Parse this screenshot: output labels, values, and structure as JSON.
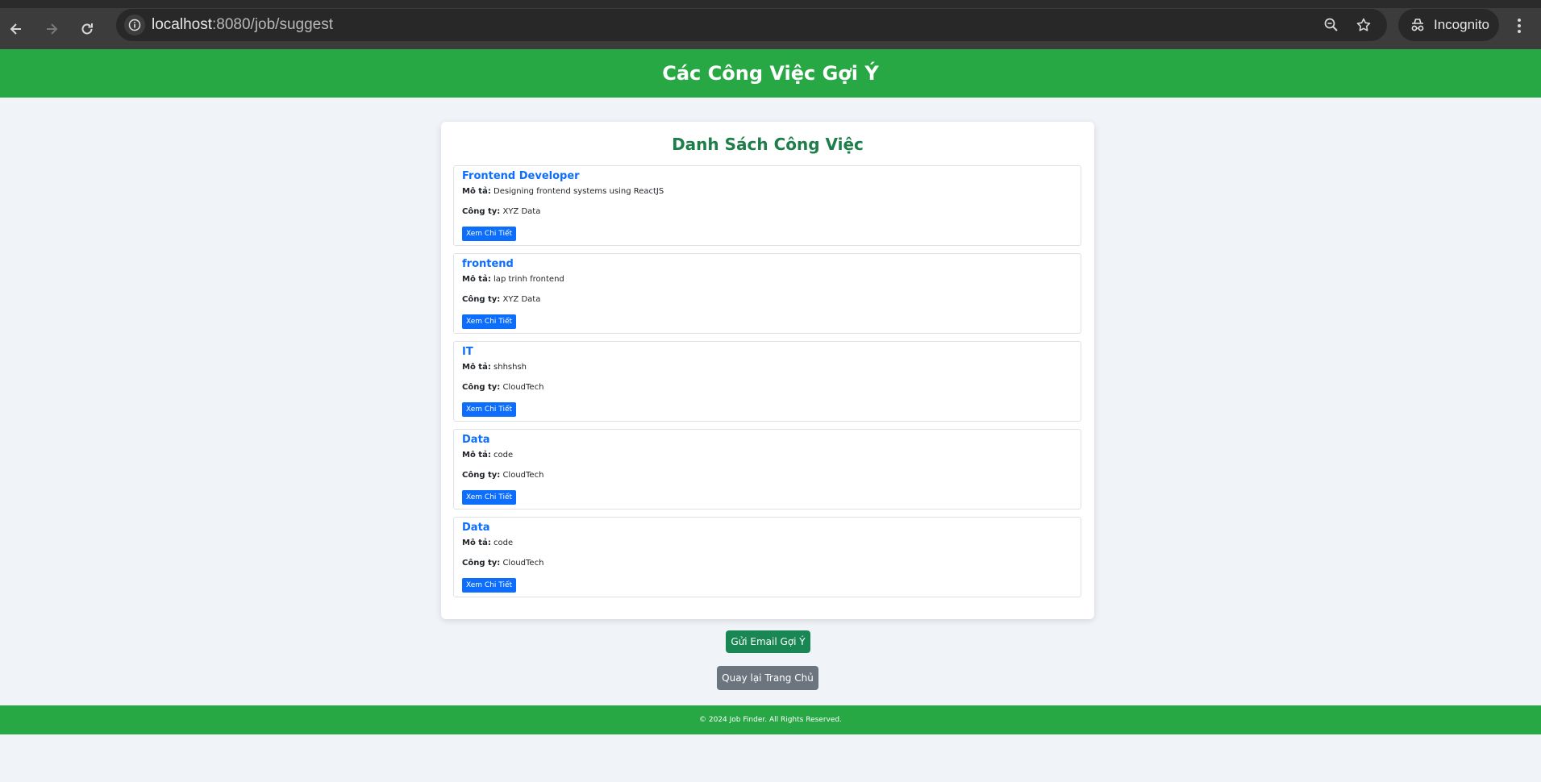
{
  "browser": {
    "url_host": "localhost",
    "url_path": ":8080/job/suggest",
    "profile_label": "Incognito",
    "icons": [
      "back-icon",
      "forward-icon",
      "reload-icon",
      "info-icon",
      "zoom-icon",
      "star-icon",
      "incognito-icon",
      "menu-icon"
    ]
  },
  "header": {
    "title": "Các Công Việc Gợi Ý"
  },
  "list": {
    "title": "Danh Sách Công Việc",
    "desc_label": "Mô tả:",
    "company_label": "Công ty:",
    "detail_button_label": "Xem Chi Tiết",
    "jobs": [
      {
        "title": "Frontend Developer",
        "description": "Designing frontend systems using ReactJS",
        "company": "XYZ Data"
      },
      {
        "title": "frontend",
        "description": "lap trinh frontend",
        "company": "XYZ Data"
      },
      {
        "title": "IT",
        "description": "shhshsh",
        "company": "CloudTech"
      },
      {
        "title": "Data",
        "description": "code",
        "company": "CloudTech"
      },
      {
        "title": "Data",
        "description": "code",
        "company": "CloudTech"
      }
    ]
  },
  "actions": {
    "send_email_label": "Gửi Email Gợi Ý",
    "back_home_label": "Quay lại Trang Chủ"
  },
  "footer": {
    "text": "© 2024 Job Finder. All Rights Reserved."
  },
  "colors": {
    "header_bg": "#28a745",
    "primary": "#0d6efd",
    "success": "#198754",
    "secondary": "#6c757d",
    "title_green": "#1e7e4a"
  }
}
